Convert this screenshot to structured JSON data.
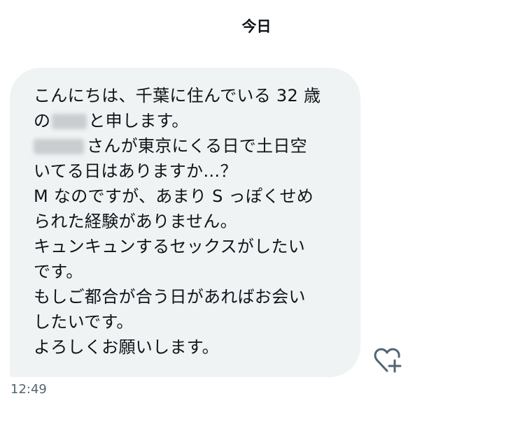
{
  "date_header": "今日",
  "message": {
    "lines": [
      {
        "before": "こんにちは、千葉に住んでいる 32 歳",
        "after": ""
      },
      {
        "before": "の",
        "after": "と申します。"
      },
      {
        "before": "",
        "after": "さんが東京にくる日で土日空"
      },
      {
        "before": "いてる日はありますか…？",
        "after": ""
      },
      {
        "before": "M なのですが、あまり S っぽくせめ",
        "after": ""
      },
      {
        "before": "られた経験がありません。",
        "after": ""
      },
      {
        "before": "キュンキュンするセックスがしたい",
        "after": ""
      },
      {
        "before": "です。",
        "after": ""
      },
      {
        "before": "もしご都合が合う日があればお会い",
        "after": ""
      },
      {
        "before": "したいです。",
        "after": ""
      },
      {
        "before": "よろしくお願いします。",
        "after": ""
      }
    ],
    "timestamp": "12:49"
  },
  "react_icon": "heart-plus-icon",
  "colors": {
    "bubble_bg": "#eff3f4",
    "text": "#0f1419",
    "muted": "#536471",
    "icon": "#536471"
  }
}
